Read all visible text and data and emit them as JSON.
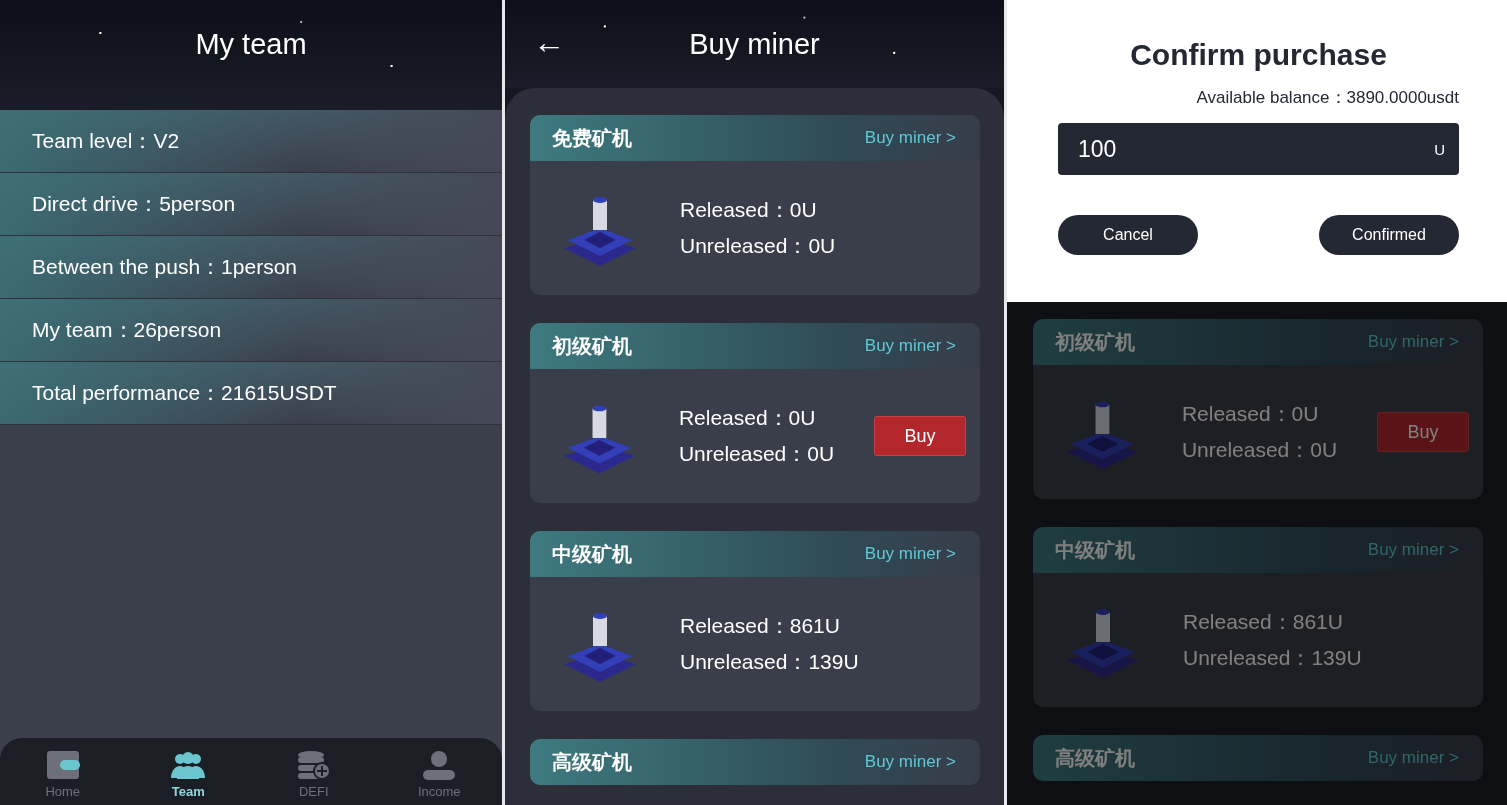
{
  "team_screen": {
    "title": "My team",
    "stats": [
      "Team level：V2",
      "Direct drive：5person",
      "Between the push：1person",
      "My team：26person",
      "Total performance：21615USDT"
    ],
    "nav": [
      {
        "label": "Home",
        "selected": false
      },
      {
        "label": "Team",
        "selected": true
      },
      {
        "label": "DEFI",
        "selected": false
      },
      {
        "label": "Income",
        "selected": false
      }
    ]
  },
  "buy_screen": {
    "back": "←",
    "title": "Buy miner",
    "miners": [
      {
        "name": "免费矿机",
        "link": "Buy miner >",
        "released": "Released：0U",
        "unreleased": "Unreleased：0U"
      },
      {
        "name": "初级矿机",
        "link": "Buy miner >",
        "released": "Released：0U",
        "unreleased": "Unreleased：0U",
        "buy_button": "Buy"
      },
      {
        "name": "中级矿机",
        "link": "Buy miner >",
        "released": "Released：861U",
        "unreleased": "Unreleased：139U"
      },
      {
        "name": "高级矿机",
        "link": "Buy miner >"
      }
    ]
  },
  "confirm_screen": {
    "dialog": {
      "title": "Confirm purchase",
      "balance": "Available balance：3890.0000usdt",
      "amount": "100",
      "unit": "U",
      "cancel": "Cancel",
      "confirm": "Confirmed"
    },
    "miners": [
      {
        "name": "初级矿机",
        "link": "Buy miner >",
        "released": "Released：0U",
        "unreleased": "Unreleased：0U",
        "buy_button": "Buy"
      },
      {
        "name": "中级矿机",
        "link": "Buy miner >",
        "released": "Released：861U",
        "unreleased": "Unreleased：139U"
      },
      {
        "name": "高级矿机",
        "link": "Buy miner >"
      }
    ]
  }
}
